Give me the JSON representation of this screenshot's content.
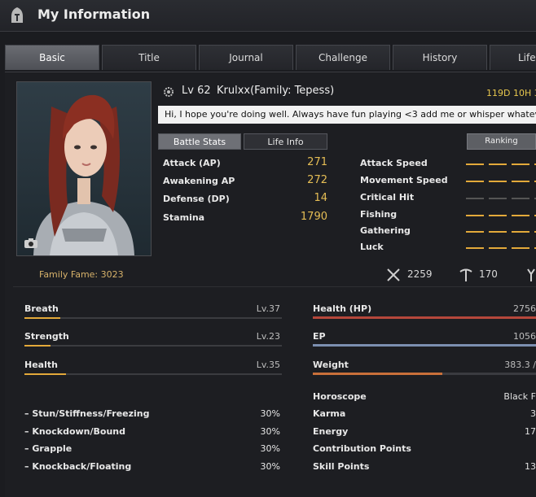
{
  "window": {
    "title": "My Information"
  },
  "tabs": [
    {
      "label": "Basic",
      "active": true
    },
    {
      "label": "Title",
      "active": false
    },
    {
      "label": "Journal",
      "active": false
    },
    {
      "label": "Challenge",
      "active": false
    },
    {
      "label": "History",
      "active": false
    },
    {
      "label": "Life",
      "active": false
    }
  ],
  "profile": {
    "level_prefix": "Lv",
    "level": "62",
    "name": "Krulxx(Family: Tepess)",
    "timer": "119D 10H 3",
    "bio": "Hi, I hope you're doing well. Always have fun playing <3 add me or whisper whatever, it's",
    "family_fame_label": "Family Fame:",
    "family_fame_value": "3023"
  },
  "subtabs": {
    "battle_stats": "Battle Stats",
    "life_info": "Life Info",
    "ranking": "Ranking"
  },
  "battle_stats": [
    {
      "label": "Attack (AP)",
      "value": "271"
    },
    {
      "label": "Awakening AP",
      "value": "272"
    },
    {
      "label": "Defense (DP)",
      "value": "14"
    },
    {
      "label": "Stamina",
      "value": "1790"
    }
  ],
  "speeds": [
    {
      "label": "Attack Speed",
      "level": 4
    },
    {
      "label": "Movement Speed",
      "level": 4
    },
    {
      "label": "Critical Hit",
      "level": 0
    },
    {
      "label": "Fishing",
      "level": 4
    },
    {
      "label": "Gathering",
      "level": 4
    },
    {
      "label": "Luck",
      "level": 4
    }
  ],
  "counters": {
    "first": "2259",
    "second": "170"
  },
  "skills": [
    {
      "label": "Breath",
      "level": "Lv.37",
      "progress": 0.14
    },
    {
      "label": "Strength",
      "level": "Lv.23",
      "progress": 0.1
    },
    {
      "label": "Health",
      "level": "Lv.35",
      "progress": 0.16
    }
  ],
  "resistances": [
    {
      "label": "– Stun/Stiffness/Freezing",
      "value": "30%"
    },
    {
      "label": "– Knockdown/Bound",
      "value": "30%"
    },
    {
      "label": "– Grapple",
      "value": "30%"
    },
    {
      "label": "– Knockback/Floating",
      "value": "30%"
    }
  ],
  "vitals": [
    {
      "label": "Health (HP)",
      "value": "2756",
      "fill": 1.0,
      "color": "#b5473b"
    },
    {
      "label": "EP",
      "value": "1056",
      "fill": 1.0,
      "color": "#7c8fb0"
    },
    {
      "label": "Weight",
      "value": "383.3 /",
      "fill": 0.58,
      "color": "#c9703a"
    }
  ],
  "info": [
    {
      "label": "Horoscope",
      "value": "Black F"
    },
    {
      "label": "Karma",
      "value": "3"
    },
    {
      "label": "Energy",
      "value": "17"
    },
    {
      "label": "Contribution Points",
      "value": ""
    },
    {
      "label": "Skill Points",
      "value": "13"
    }
  ],
  "colors": {
    "accent": "#e6be55",
    "fame": "#d7b26a",
    "timer": "#e8c74e"
  }
}
